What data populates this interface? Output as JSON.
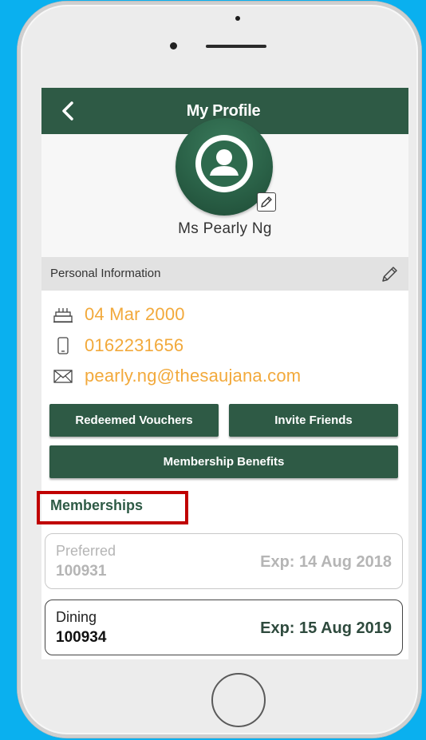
{
  "header": {
    "title": "My Profile"
  },
  "profile": {
    "name": "Ms Pearly Ng"
  },
  "personal_info": {
    "section_label": "Personal Information",
    "birthday": "04 Mar 2000",
    "phone": "0162231656",
    "email": "pearly.ng@thesaujana.com"
  },
  "actions": {
    "redeemed_vouchers": "Redeemed Vouchers",
    "invite_friends": "Invite Friends",
    "membership_benefits": "Membership Benefits"
  },
  "memberships": {
    "title": "Memberships",
    "items": [
      {
        "type": "Preferred",
        "number": "100931",
        "expiry": "Exp: 14 Aug 2018",
        "state": "expired"
      },
      {
        "type": "Dining",
        "number": "100934",
        "expiry": "Exp: 15 Aug 2019",
        "state": "active"
      }
    ]
  },
  "colors": {
    "brand_green": "#2e5a45",
    "info_orange": "#f2a93b",
    "highlight_red": "#c00000",
    "background_blue": "#0ab0ef"
  }
}
